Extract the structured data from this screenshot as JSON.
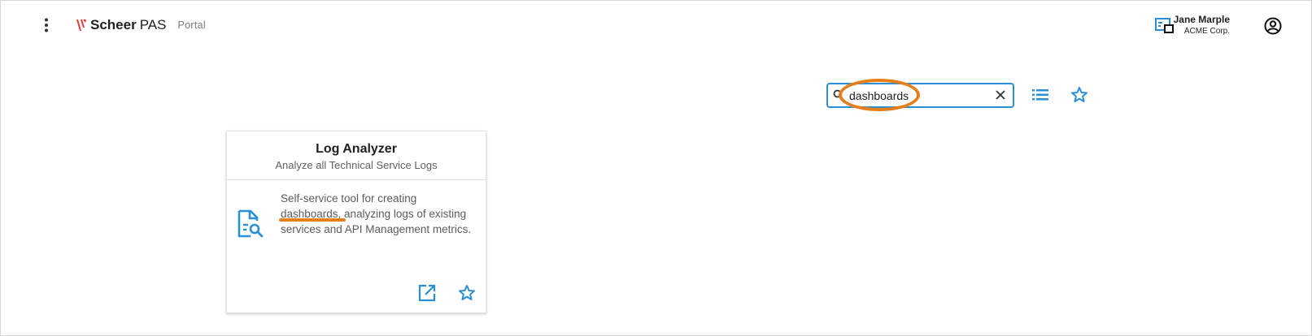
{
  "header": {
    "brand_bold": "Scheer",
    "brand_regular": "PAS",
    "portal_label": "Portal",
    "user_name": "Jane Marple",
    "user_org": "ACME Corp."
  },
  "search": {
    "value": "dashboards",
    "placeholder": ""
  },
  "card": {
    "title": "Log Analyzer",
    "subtitle": "Analyze all Technical Service Logs",
    "description": "Self-service tool for creating dashboards, analyzing logs of existing services and API Management metrics."
  },
  "icons": {
    "menu": "more-vert-icon",
    "device": "devices-icon",
    "account": "account-circle-icon",
    "search": "search-icon",
    "clear": "close-icon",
    "list_view": "list-icon",
    "favorites": "star-outline-icon",
    "app": "document-search-icon",
    "open": "open-in-new-icon"
  },
  "colors": {
    "accent": "#2a8fd4",
    "brand_mark": "#e53935",
    "highlight": "#e67e1a"
  }
}
